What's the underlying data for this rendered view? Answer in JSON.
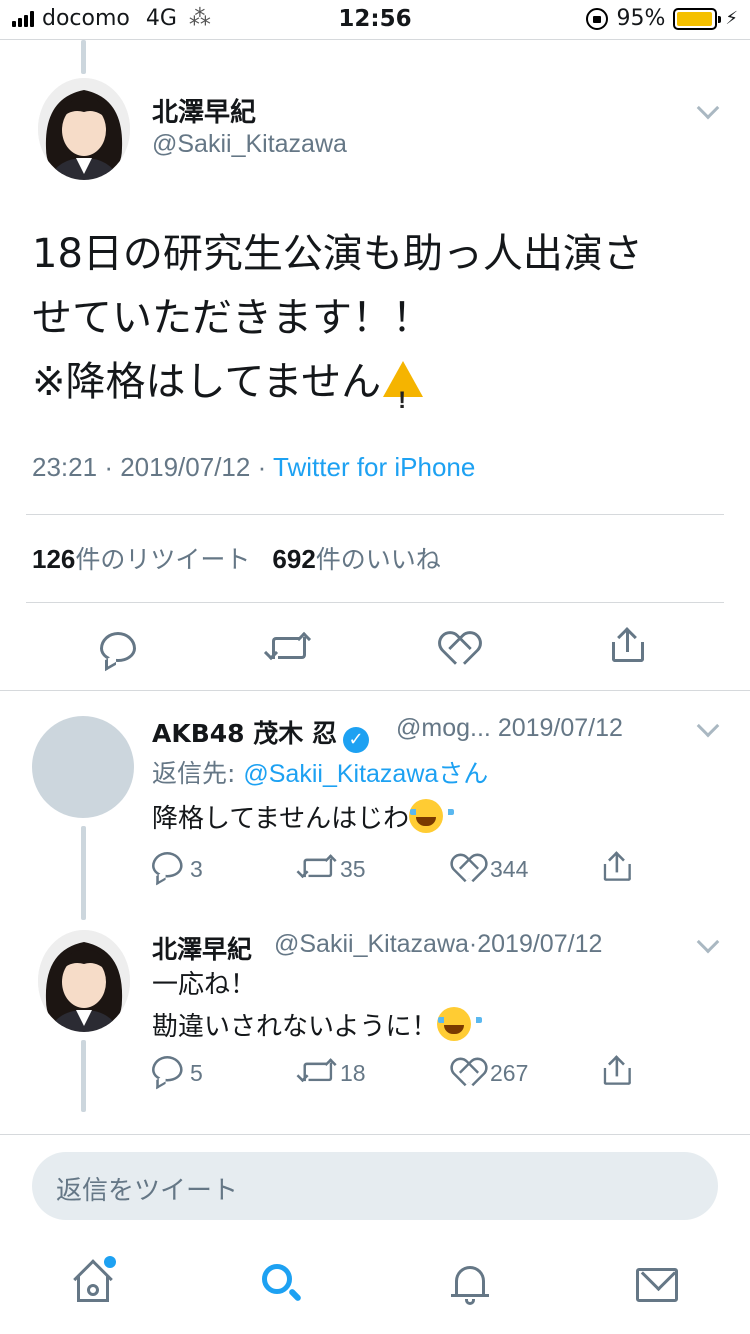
{
  "status_bar": {
    "carrier": "docomo",
    "network": "4G",
    "time": "12:56",
    "battery_percent": "95%",
    "battery_level": 0.95,
    "battery_color": "#f5c000"
  },
  "main_tweet": {
    "display_name": "北澤早紀",
    "handle": "@Sakii_Kitazawa",
    "text_lines": [
      "18日の研究生公演も助っ人出演さ",
      "せていただきます！！",
      "※降格はしてません"
    ],
    "text_emoji": "warning-sign",
    "time": "23:21",
    "date": "2019/07/12",
    "separator": "·",
    "source": "Twitter for iPhone",
    "retweet_count": "126",
    "retweet_label": "件のリツイート",
    "like_count": "692",
    "like_label": "件のいいね"
  },
  "replies": [
    {
      "display_name": "AKB48 茂木 忍",
      "verified": true,
      "handle": "@mog...",
      "date": "2019/07/12",
      "reply_to_label": "返信先: ",
      "reply_to_mention": "@Sakii_Kitazawa",
      "reply_to_suffix": "さん",
      "text_lines": [
        "降格してませんはじわ"
      ],
      "text_emoji": "face-with-tears-of-joy",
      "reply_count": "3",
      "retweet_count": "35",
      "like_count": "344"
    },
    {
      "display_name": "北澤早紀",
      "verified": false,
      "handle": "@Sakii_Kitazawa",
      "separator": "·",
      "date": "2019/07/12",
      "text_lines": [
        "一応ね！",
        "勘違いされないように！"
      ],
      "text_emoji": "face-with-tears-of-joy",
      "reply_count": "5",
      "retweet_count": "18",
      "like_count": "267"
    }
  ],
  "composer": {
    "placeholder": "返信をツイート"
  },
  "tab_bar": {
    "items": [
      "home-icon",
      "search-icon",
      "bell-icon",
      "mail-icon"
    ],
    "active": "search-icon",
    "accent_color": "#1da1f2"
  }
}
